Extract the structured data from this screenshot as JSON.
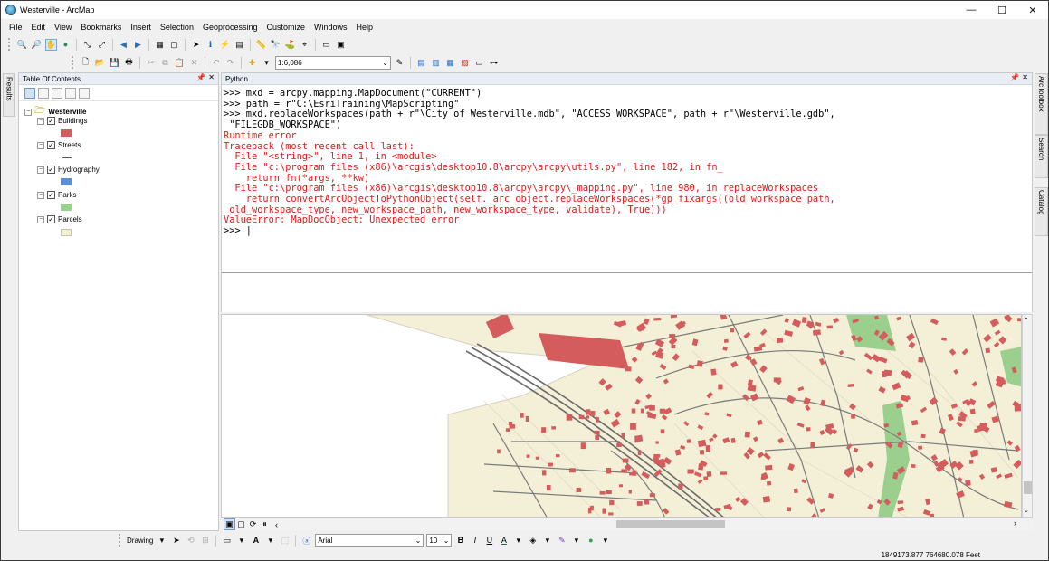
{
  "window": {
    "title": "Westerville - ArcMap",
    "minimize": "—",
    "maximize": "☐",
    "close": "✕"
  },
  "menu": [
    "File",
    "Edit",
    "View",
    "Bookmarks",
    "Insert",
    "Selection",
    "Geoprocessing",
    "Customize",
    "Windows",
    "Help"
  ],
  "toolbar": {
    "scale_value": "1:6,086"
  },
  "left_tabs": {
    "results": "Results"
  },
  "toc": {
    "title": "Table Of Contents",
    "root": "Westerville",
    "layers": [
      {
        "name": "Buildings",
        "color": "#d45c5c"
      },
      {
        "name": "Streets",
        "color": "#555555"
      },
      {
        "name": "Hydrography",
        "color": "#5b8fd6"
      },
      {
        "name": "Parks",
        "color": "#9bcf8e"
      },
      {
        "name": "Parcels",
        "color": "#f3f0d7"
      }
    ]
  },
  "python": {
    "title": "Python",
    "lines": [
      {
        "text": ">>> mxd = arcpy.mapping.MapDocument(\"CURRENT\")",
        "style": "blk"
      },
      {
        "text": ">>> path = r\"C:\\EsriTraining\\MapScripting\"",
        "style": "blk"
      },
      {
        "text": ">>> mxd.replaceWorkspaces(path + r\"\\City_of_Westerville.mdb\", \"ACCESS_WORKSPACE\", path + r\"\\Westerville.gdb\",",
        "style": "blk"
      },
      {
        "text": " \"FILEGDB_WORKSPACE\")",
        "style": "blk"
      },
      {
        "text": "Runtime error",
        "style": "red"
      },
      {
        "text": "Traceback (most recent call last):",
        "style": "red"
      },
      {
        "text": "  File \"<string>\", line 1, in <module>",
        "style": "red"
      },
      {
        "text": "  File \"c:\\program files (x86)\\arcgis\\desktop10.8\\arcpy\\arcpy\\utils.py\", line 182, in fn_",
        "style": "red"
      },
      {
        "text": "    return fn(*args, **kw)",
        "style": "red"
      },
      {
        "text": "  File \"c:\\program files (x86)\\arcgis\\desktop10.8\\arcpy\\arcpy\\_mapping.py\", line 980, in replaceWorkspaces",
        "style": "red"
      },
      {
        "text": "    return convertArcObjectToPythonObject(self._arc_object.replaceWorkspaces(*gp_fixargs((old_workspace_path,",
        "style": "red"
      },
      {
        "text": " old_workspace_type, new_workspace_path, new_workspace_type, validate), True)))",
        "style": "red"
      },
      {
        "text": "ValueError: MapDocObject: Unexpected error",
        "style": "red"
      },
      {
        "text": ">>> |",
        "style": "blk"
      }
    ]
  },
  "right_tabs": {
    "arctoolbox": "ArcToolbox",
    "search": "Search",
    "catalog": "Catalog"
  },
  "drawing": {
    "label": "Drawing",
    "font": "Arial",
    "size": "10"
  },
  "status": {
    "coordinates": "1849173.877  764680.078 Feet"
  },
  "colors": {
    "parcel": "#f3f0d7",
    "building": "#d45c5c",
    "street": "#6b6b6b",
    "park": "#9bcf8e",
    "error_text": "#e01b1b"
  }
}
